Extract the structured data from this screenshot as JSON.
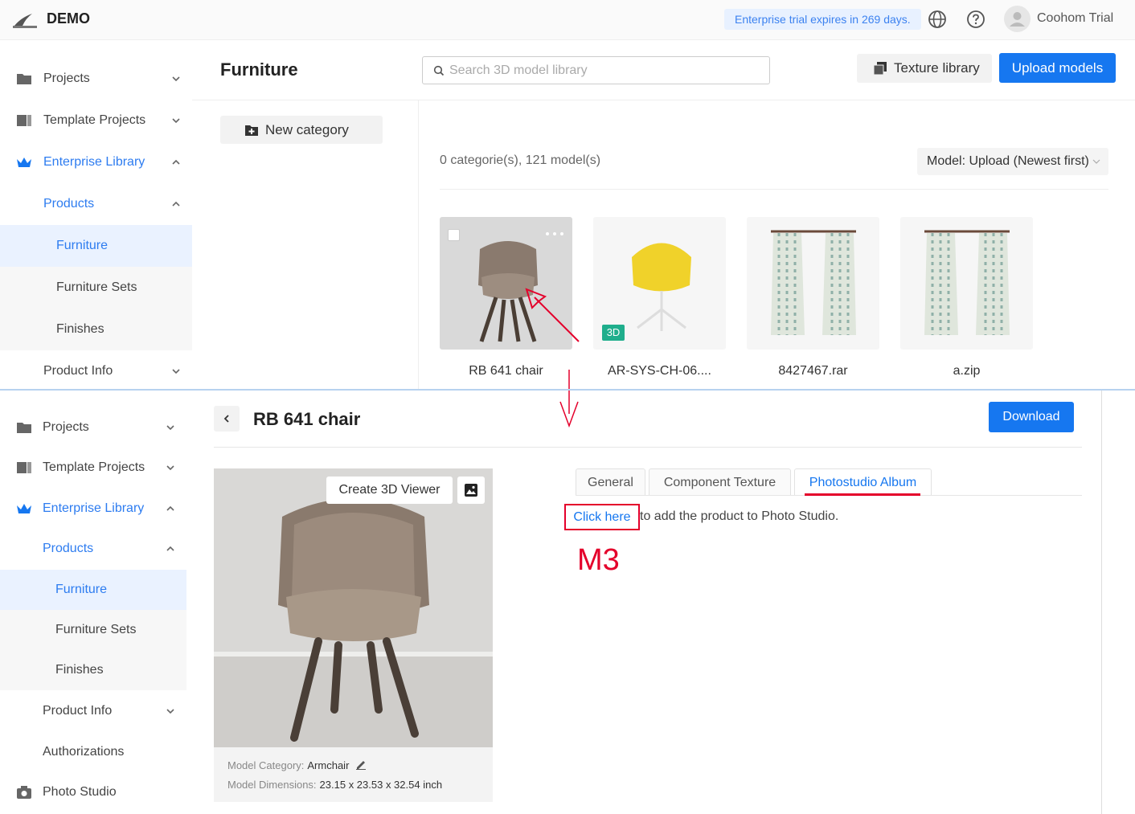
{
  "header": {
    "brand": "DEMO",
    "trial_notice": "Enterprise trial expires in 269 days.",
    "user_name": "Coohom Trial",
    "accent": "#1677f0"
  },
  "sidebar_top": [
    {
      "label": "Projects",
      "icon": "folder-icon"
    },
    {
      "label": "Template Projects",
      "icon": "template-icon"
    },
    {
      "label": "Enterprise Library",
      "icon": "crown-icon"
    },
    {
      "label": "Products"
    },
    {
      "label": "Furniture"
    },
    {
      "label": "Furniture Sets"
    },
    {
      "label": "Finishes"
    },
    {
      "label": "Product Info"
    }
  ],
  "sidebar_bottom": [
    {
      "label": "Projects",
      "icon": "folder-icon"
    },
    {
      "label": "Template Projects",
      "icon": "template-icon"
    },
    {
      "label": "Enterprise Library",
      "icon": "crown-icon"
    },
    {
      "label": "Products"
    },
    {
      "label": "Furniture"
    },
    {
      "label": "Furniture Sets"
    },
    {
      "label": "Finishes"
    },
    {
      "label": "Product Info"
    },
    {
      "label": "Authorizations"
    },
    {
      "label": "Photo Studio",
      "icon": "camera-icon"
    }
  ],
  "library": {
    "title": "Furniture",
    "search_placeholder": "Search 3D model library",
    "texture_library": "Texture library",
    "upload_models": "Upload models",
    "new_category": "New category",
    "stats": "0 categorie(s), 121 model(s)",
    "sort": "Model: Upload (Newest first)",
    "models": [
      {
        "name": "RB 641 chair"
      },
      {
        "name": "AR-SYS-CH-06....",
        "badge": "3D"
      },
      {
        "name": "8427467.rar"
      },
      {
        "name": "a.zip"
      }
    ]
  },
  "detail": {
    "title": "RB 641 chair",
    "download": "Download",
    "create_viewer": "Create 3D Viewer",
    "category_label": "Model Category:",
    "category_value": "Armchair",
    "dimensions_label": "Model Dimensions:",
    "dimensions_value": "23.15 x 23.53 x 32.54 inch",
    "tabs": [
      "General",
      "Component Texture",
      "Photostudio Album"
    ],
    "active_tab": "Photostudio Album",
    "click_here": "Click here",
    "click_rest": "to add the product to Photo Studio.",
    "annotation": "M3",
    "annotation_color": "#e4002b"
  }
}
